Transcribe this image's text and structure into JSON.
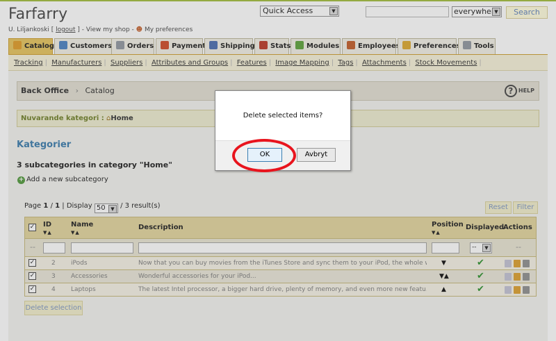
{
  "header": {
    "shop_name": "Farfarry",
    "user_name": "U. Liljankoski",
    "logout": "logout",
    "view_shop": "View my shop",
    "preferences": "My preferences",
    "quick_access": "Quick Access",
    "search_scope": "everywhere",
    "search_button": "Search"
  },
  "tabs": [
    {
      "label": "Catalog",
      "icon": "catalog-icon",
      "color": "#e3a43a"
    },
    {
      "label": "Customers",
      "icon": "customers-icon",
      "color": "#5a8cc8"
    },
    {
      "label": "Orders",
      "icon": "orders-icon",
      "color": "#9aa0a8"
    },
    {
      "label": "Payment",
      "icon": "payment-icon",
      "color": "#d45a3a"
    },
    {
      "label": "Shipping",
      "icon": "shipping-icon",
      "color": "#5a7ab8"
    },
    {
      "label": "Stats",
      "icon": "stats-icon",
      "color": "#c24a3a"
    },
    {
      "label": "Modules",
      "icon": "modules-icon",
      "color": "#6aaa4a"
    },
    {
      "label": "Employees",
      "icon": "employees-icon",
      "color": "#c86a3a"
    },
    {
      "label": "Preferences",
      "icon": "preferences-icon",
      "color": "#e0b040"
    },
    {
      "label": "Tools",
      "icon": "tools-icon",
      "color": "#9aa0a8"
    }
  ],
  "subnav": [
    "Tracking",
    "Manufacturers",
    "Suppliers",
    "Attributes and Groups",
    "Features",
    "Image Mapping",
    "Tags",
    "Attachments",
    "Stock Movements"
  ],
  "breadcrumb": {
    "root": "Back Office",
    "separator": "›",
    "current": "Catalog",
    "help": "HELP"
  },
  "category_bar": {
    "label": "Nuvarande kategori :",
    "home": "Home"
  },
  "section_title": "Kategorier",
  "subcount": "3 subcategories in category \"Home\"",
  "add_subcategory": "Add a new subcategory",
  "pager": {
    "page_prefix": "Page",
    "page": "1",
    "sep": "/",
    "total_pages": "1",
    "display_label": "| Display",
    "display_value": "50",
    "results": "/ 3 result(s)"
  },
  "reset": "Reset",
  "filter": "Filter",
  "table": {
    "columns": {
      "id": "ID",
      "name": "Name",
      "description": "Description",
      "position": "Position",
      "displayed": "Displayed",
      "actions": "Actions"
    },
    "filter_dash": "--",
    "rows": [
      {
        "id": "2",
        "name": "iPods",
        "description": "Now that you can buy movies from the iTunes Store and sync them to your iPod, the whole wo...",
        "position": "▼",
        "displayed": "✔"
      },
      {
        "id": "3",
        "name": "Accessories",
        "description": "Wonderful accessories for your iPod...",
        "position": "▼▲",
        "displayed": "✔"
      },
      {
        "id": "4",
        "name": "Laptops",
        "description": "The latest Intel processor, a bigger hard drive, plenty of memory, and even more new featu...",
        "position": "▲",
        "displayed": "✔"
      }
    ]
  },
  "delete_selection": "Delete selection",
  "dialog": {
    "message": "Delete selected items?",
    "ok": "OK",
    "cancel": "Avbryt"
  }
}
